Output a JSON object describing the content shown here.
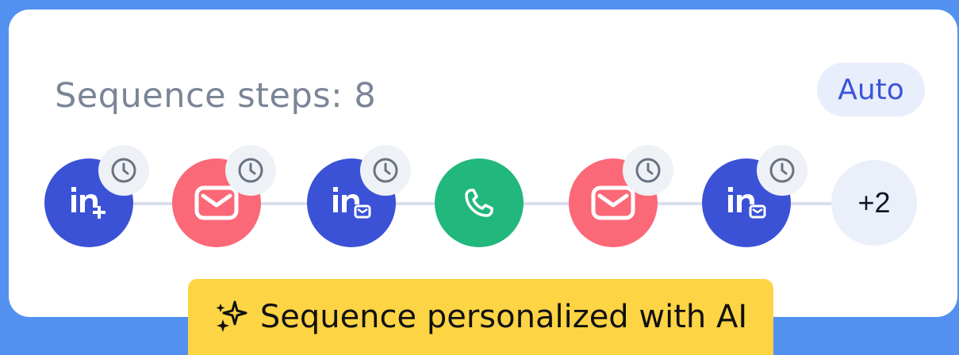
{
  "card": {
    "title": "Sequence steps: 8",
    "mode_badge": "Auto"
  },
  "steps": [
    {
      "type": "linkedin-connect",
      "icon": "linkedin-connect-icon",
      "delayed": true
    },
    {
      "type": "email",
      "icon": "email-icon",
      "delayed": true
    },
    {
      "type": "linkedin-message",
      "icon": "linkedin-message-icon",
      "delayed": true
    },
    {
      "type": "call",
      "icon": "phone-icon",
      "delayed": false
    },
    {
      "type": "email",
      "icon": "email-icon",
      "delayed": true
    },
    {
      "type": "linkedin-message",
      "icon": "linkedin-message-icon",
      "delayed": true
    }
  ],
  "more_steps": "+2",
  "ai_banner": {
    "icon": "sparkles-icon",
    "text": "Sequence personalized with AI"
  },
  "colors": {
    "background": "#5291ef",
    "linkedin": "#3b52d6",
    "email": "#fb6878",
    "call": "#22b77c",
    "badge_text": "#3b55d9",
    "banner": "#fdd443"
  }
}
